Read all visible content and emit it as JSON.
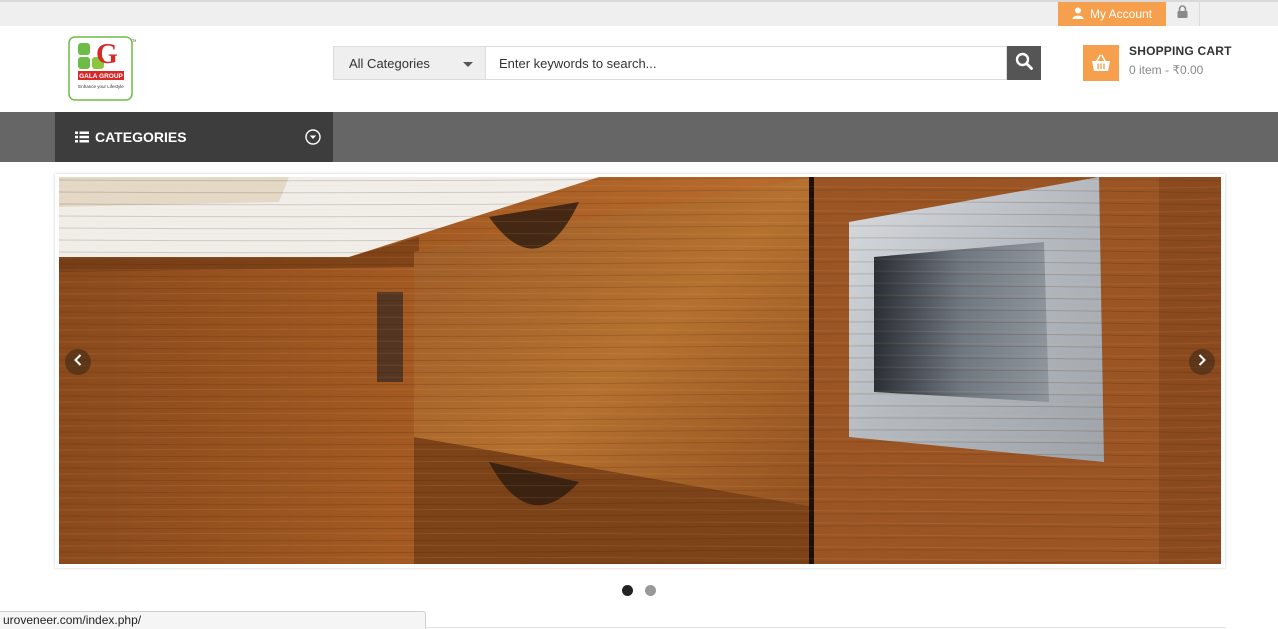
{
  "topbar": {
    "account_label": "My Account",
    "icons": {
      "account": "user-icon",
      "lock": "lock-icon"
    },
    "accent": "#f6a04d"
  },
  "header": {
    "logo": {
      "brand": "GALA GROUP",
      "tagline": "Enhance your Lifestyle",
      "letter": "G",
      "tm": "TM"
    },
    "search": {
      "category_selected": "All Categories",
      "placeholder": "Enter keywords to search...",
      "button_icon": "search-icon"
    },
    "cart": {
      "title": "SHOPPING CART",
      "summary": "0 item - ₹0.00",
      "icon": "basket-icon"
    }
  },
  "nav": {
    "categories_label": "CATEGORIES",
    "icons": {
      "list": "list-icon",
      "toggle": "chevron-circle-down-icon"
    }
  },
  "slider": {
    "active_slide": 1,
    "slide_count": 2,
    "prev_icon": "chevron-left-icon",
    "next_icon": "chevron-right-icon"
  },
  "statusbar": {
    "url": "uroveneer.com/index.php/"
  },
  "colors": {
    "nav_bg": "#666666",
    "categories_bg": "#3d3d3d",
    "search_button": "#555555"
  }
}
